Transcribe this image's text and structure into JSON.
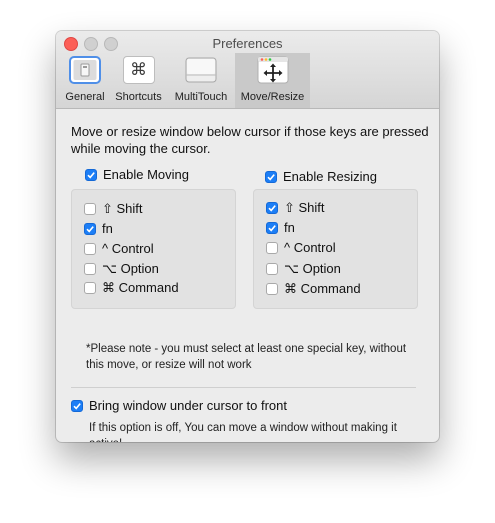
{
  "window": {
    "title": "Preferences"
  },
  "toolbar": {
    "tabs": [
      {
        "label": "General",
        "icon": "general-icon",
        "selected": false
      },
      {
        "label": "Shortcuts",
        "icon": "command-key-icon",
        "selected": false
      },
      {
        "label": "MultiTouch",
        "icon": "trackpad-icon",
        "selected": false
      },
      {
        "label": "Move/Resize",
        "icon": "move-arrows-icon",
        "selected": true
      }
    ],
    "shortcuts_glyph": "⌘"
  },
  "main": {
    "intro": "Move or resize window below cursor if those keys are pressed while moving the cursor.",
    "moving": {
      "label": "Enable Moving",
      "checked": true,
      "keys": [
        {
          "label": "⇧ Shift",
          "checked": false
        },
        {
          "label": "fn",
          "checked": true
        },
        {
          "label": "^ Control",
          "checked": false
        },
        {
          "label": "⌥ Option",
          "checked": false
        },
        {
          "label": "⌘ Command",
          "checked": false
        }
      ]
    },
    "resizing": {
      "label": "Enable Resizing",
      "checked": true,
      "keys": [
        {
          "label": "⇧ Shift",
          "checked": true
        },
        {
          "label": "fn",
          "checked": true
        },
        {
          "label": "^ Control",
          "checked": false
        },
        {
          "label": "⌥ Option",
          "checked": false
        },
        {
          "label": "⌘ Command",
          "checked": false
        }
      ]
    },
    "note": "*Please note - you must select at least one special key, without this move, or resize will not work",
    "bring_front": {
      "label": "Bring window under cursor to front",
      "checked": true,
      "description": "If this option is off, You can move a window without making it active!"
    }
  },
  "colors": {
    "accent": "#1c7ef6",
    "close": "#fc5f57"
  }
}
